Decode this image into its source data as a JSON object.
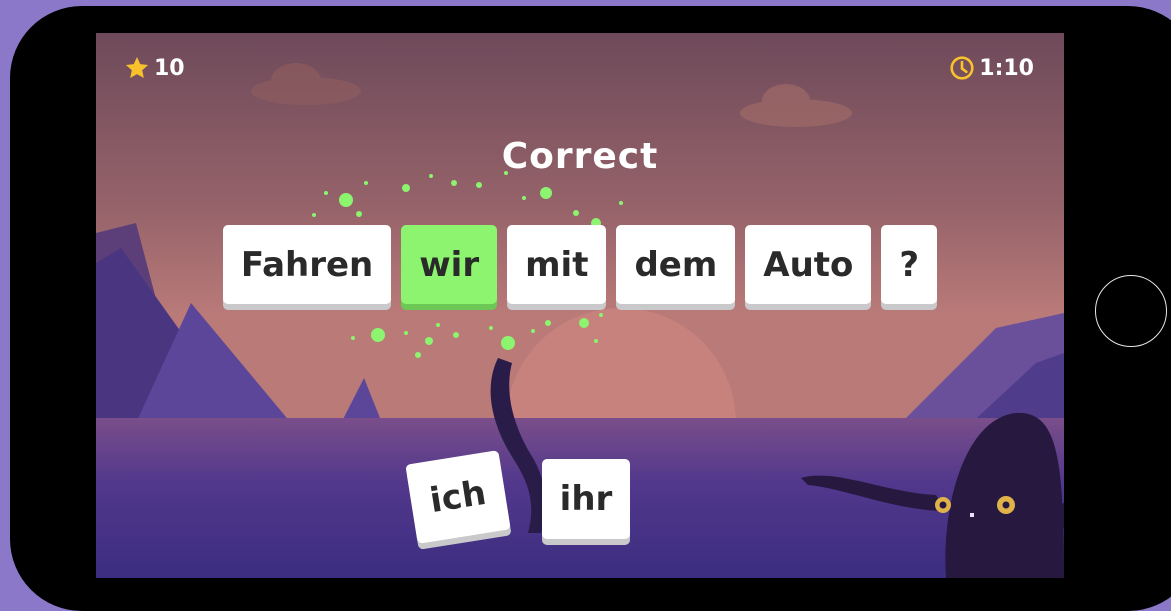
{
  "hud": {
    "score": "10",
    "score_icon": "star-icon",
    "timer": "1:10",
    "timer_icon": "clock-icon"
  },
  "feedback": "Correct",
  "sentence": [
    "Fahren",
    "wir",
    "mit",
    "dem",
    "Auto",
    "?"
  ],
  "highlighted_word": "wir",
  "choices": [
    "ich",
    "ihr"
  ],
  "colors": {
    "highlight": "#8cf46e",
    "star": "#f7c22b",
    "timer": "#f7c22b",
    "particles": "#8cf46e"
  }
}
